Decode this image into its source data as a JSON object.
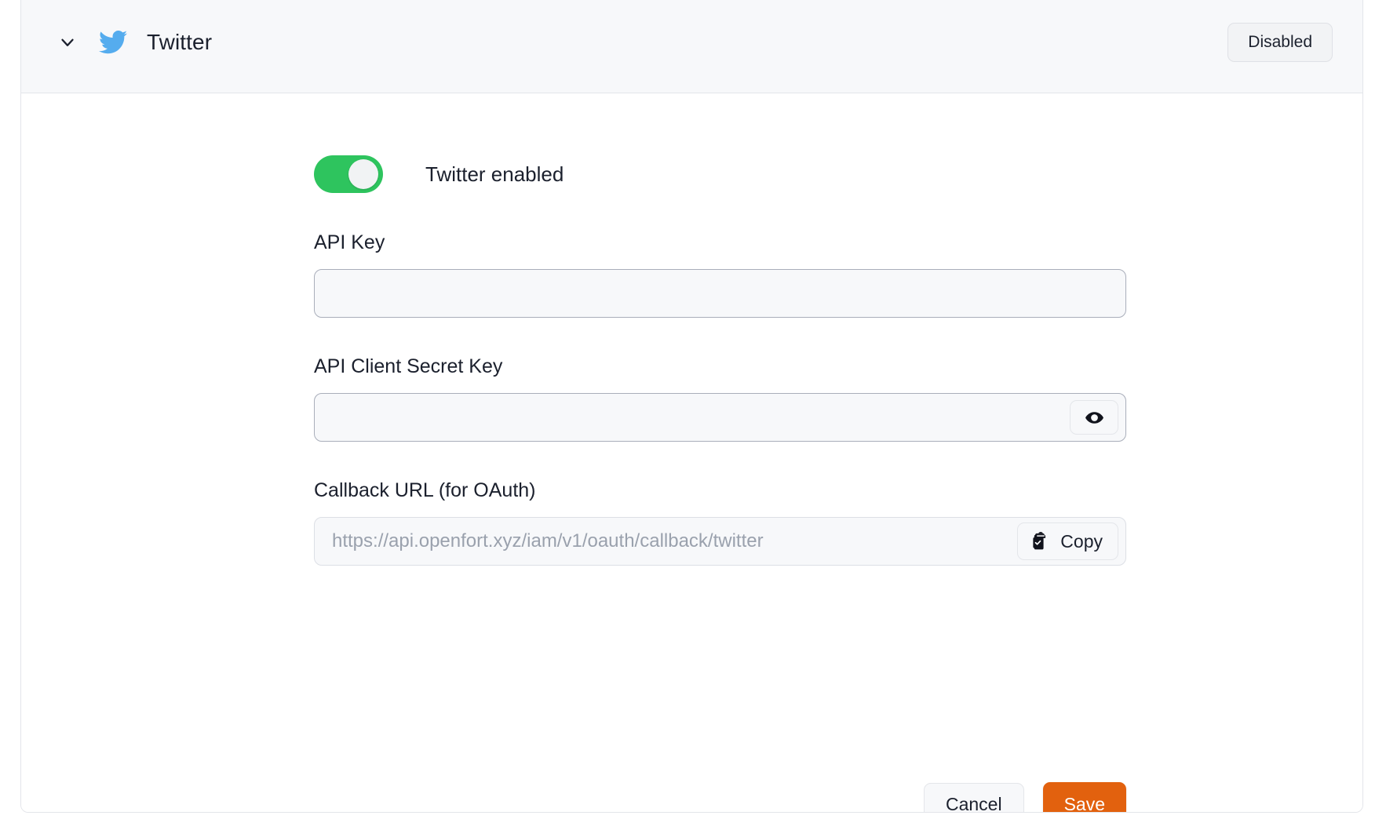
{
  "card": {
    "header": {
      "chevron_icon": "chevron-down-icon",
      "logo_icon": "twitter-bird-icon",
      "provider_name": "Twitter",
      "status_label": "Disabled",
      "logo_color": "#55acee",
      "header_bg": "#f7f8fa"
    },
    "form": {
      "toggle": {
        "label": "Twitter enabled",
        "state": "on",
        "on_color": "#2ec45e"
      },
      "api_key": {
        "label": "API Key",
        "value": "",
        "placeholder": ""
      },
      "api_secret": {
        "label": "API Client Secret Key",
        "value": "",
        "placeholder": "",
        "reveal_icon": "eye-icon"
      },
      "callback_url": {
        "label": "Callback URL (for OAuth)",
        "value": "https://api.openfort.xyz/iam/v1/oauth/callback/twitter",
        "copy_label": "Copy",
        "copy_icon": "clipboard-check-icon"
      },
      "actions": {
        "cancel_label": "Cancel",
        "save_label": "Save",
        "save_color": "#e2610e"
      }
    }
  }
}
